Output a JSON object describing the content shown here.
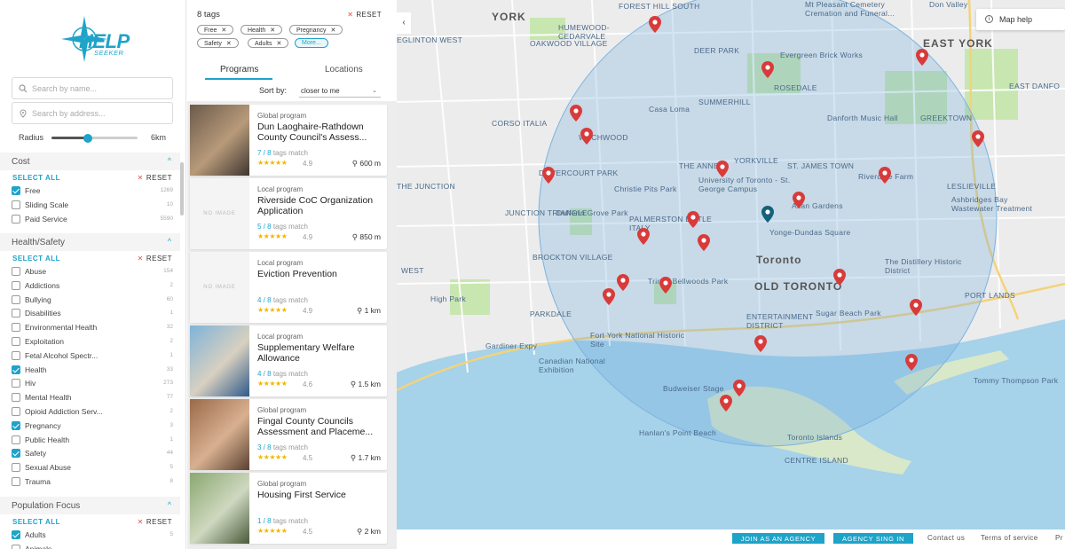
{
  "brand": {
    "name": "HELP",
    "sub": "SEEKER"
  },
  "search": {
    "name_placeholder": "Search by name...",
    "address_placeholder": "Search by address..."
  },
  "radius": {
    "label": "Radius",
    "value": "6km",
    "fraction": 0.42
  },
  "filters": {
    "select_all": "SELECT ALL",
    "reset": "RESET",
    "cost": {
      "title": "Cost",
      "items": [
        {
          "label": "Free",
          "count": "1269",
          "checked": true
        },
        {
          "label": "Sliding Scale",
          "count": "10",
          "checked": false
        },
        {
          "label": "Paid Service",
          "count": "5590",
          "checked": false
        }
      ]
    },
    "health": {
      "title": "Health/Safety",
      "items": [
        {
          "label": "Abuse",
          "count": "154",
          "checked": false
        },
        {
          "label": "Addictions",
          "count": "2",
          "checked": false
        },
        {
          "label": "Bullying",
          "count": "60",
          "checked": false
        },
        {
          "label": "Disabilities",
          "count": "1",
          "checked": false
        },
        {
          "label": "Environmental Health",
          "count": "32",
          "checked": false
        },
        {
          "label": "Exploitation",
          "count": "2",
          "checked": false
        },
        {
          "label": "Fetal Alcohol Spectr...",
          "count": "1",
          "checked": false
        },
        {
          "label": "Health",
          "count": "33",
          "checked": true
        },
        {
          "label": "Hiv",
          "count": "273",
          "checked": false
        },
        {
          "label": "Mental Health",
          "count": "77",
          "checked": false
        },
        {
          "label": "Opioid Addiction Serv...",
          "count": "2",
          "checked": false
        },
        {
          "label": "Pregnancy",
          "count": "3",
          "checked": true
        },
        {
          "label": "Public Health",
          "count": "1",
          "checked": false
        },
        {
          "label": "Safety",
          "count": "44",
          "checked": true
        },
        {
          "label": "Sexual Abuse",
          "count": "5",
          "checked": false
        },
        {
          "label": "Trauma",
          "count": "8",
          "checked": false
        }
      ]
    },
    "population": {
      "title": "Population Focus",
      "items": [
        {
          "label": "Adults",
          "count": "5",
          "checked": true
        },
        {
          "label": "Animals",
          "count": "",
          "checked": false
        }
      ]
    }
  },
  "tags": {
    "count_label": "8 tags",
    "reset": "RESET",
    "items": [
      "Free",
      "Health",
      "Pregnancy",
      "Safety",
      "Adults"
    ],
    "more": "More..."
  },
  "tabs": {
    "programs": "Programs",
    "locations": "Locations"
  },
  "sort": {
    "label": "Sort by:",
    "value": "closer to me"
  },
  "results": [
    {
      "kind": "Global program",
      "title": "Dun Laoghaire-Rathdown County Council's Assess...",
      "match": "7 / 8",
      "match_suffix": "tags match",
      "stars": "★★★★★",
      "rating": "4.9",
      "distance": "600 m",
      "image": "photo",
      "no_image": ""
    },
    {
      "kind": "Local program",
      "title": "Riverside CoC Organization Application",
      "match": "5 / 8",
      "match_suffix": "tags match",
      "stars": "★★★★★",
      "rating": "4.9",
      "distance": "850 m",
      "image": "none",
      "no_image": "NO IMAGE"
    },
    {
      "kind": "Local program",
      "title": "Eviction Prevention",
      "match": "4 / 8",
      "match_suffix": "tags match",
      "stars": "★★★★★",
      "rating": "4.9",
      "distance": "1 km",
      "image": "none",
      "no_image": "NO IMAGE"
    },
    {
      "kind": "Local program",
      "title": "Supplementary Welfare Allowance",
      "match": "4 / 8",
      "match_suffix": "tags match",
      "stars": "★★★★★",
      "rating": "4.6",
      "distance": "1.5 km",
      "image": "photo",
      "no_image": ""
    },
    {
      "kind": "Global program",
      "title": "Fingal County Councils Assessment and Placeme...",
      "match": "3 / 8",
      "match_suffix": "tags match",
      "stars": "★★★★★",
      "rating": "4.5",
      "distance": "1.7 km",
      "image": "photo",
      "no_image": ""
    },
    {
      "kind": "Global program",
      "title": "Housing First Service",
      "match": "1 / 8",
      "match_suffix": "tags match",
      "stars": "★★★★★",
      "rating": "4.5",
      "distance": "2 km",
      "image": "photo",
      "no_image": ""
    }
  ],
  "map": {
    "help": "Map help",
    "labels": [
      {
        "t": "YORK",
        "big": true
      },
      {
        "t": "FOREST HILL SOUTH",
        "big": false
      },
      {
        "t": "HUMEWOOD-CEDARVALE",
        "big": false
      },
      {
        "t": "EGLINTON WEST",
        "big": false
      },
      {
        "t": "OAKWOOD VILLAGE",
        "big": false
      },
      {
        "t": "DEER PARK",
        "big": false
      },
      {
        "t": "Evergreen Brick Works",
        "big": false
      },
      {
        "t": "EAST YORK",
        "big": true
      },
      {
        "t": "ROSEDALE",
        "big": false
      },
      {
        "t": "SUMMERHILL",
        "big": false
      },
      {
        "t": "Casa Loma",
        "big": false
      },
      {
        "t": "CORSO ITALIA",
        "big": false
      },
      {
        "t": "WYCHWOOD",
        "big": false
      },
      {
        "t": "Danforth Music Hall",
        "big": false
      },
      {
        "t": "GREEKTOWN",
        "big": false
      },
      {
        "t": "THE ANNEX",
        "big": false
      },
      {
        "t": "YORKVILLE",
        "big": false
      },
      {
        "t": "ST. JAMES TOWN",
        "big": false
      },
      {
        "t": "THE JUNCTION",
        "big": false
      },
      {
        "t": "DOVERCOURT PARK",
        "big": false
      },
      {
        "t": "Christie Pits Park",
        "big": false
      },
      {
        "t": "University of Toronto - St. George Campus",
        "big": false
      },
      {
        "t": "Allan Gardens",
        "big": false
      },
      {
        "t": "Riverdale Farm",
        "big": false
      },
      {
        "t": "LESLIEVILLE",
        "big": false
      },
      {
        "t": "JUNCTION TRIANGLE",
        "big": false
      },
      {
        "t": "Dufferin Grove Park",
        "big": false
      },
      {
        "t": "PALMERSTON LITTLE ITALY",
        "big": false
      },
      {
        "t": "Yonge-Dundas Square",
        "big": false
      },
      {
        "t": "Ashbridges Bay Wastewater Treatment",
        "big": false
      },
      {
        "t": "Toronto",
        "big": true
      },
      {
        "t": "BROCKTON VILLAGE",
        "big": false
      },
      {
        "t": "OLD TORONTO",
        "big": true
      },
      {
        "t": "The Distillery Historic District",
        "big": false
      },
      {
        "t": "Trinity Bellwoods Park",
        "big": false
      },
      {
        "t": "WEST",
        "big": false
      },
      {
        "t": "High Park",
        "big": false
      },
      {
        "t": "PORT LANDS",
        "big": false
      },
      {
        "t": "PARKDALE",
        "big": false
      },
      {
        "t": "ENTERTAINMENT DISTRICT",
        "big": false
      },
      {
        "t": "Sugar Beach Park",
        "big": false
      },
      {
        "t": "Fort York National Historic Site",
        "big": false
      },
      {
        "t": "Canadian National Exhibition",
        "big": false
      },
      {
        "t": "Budweiser Stage",
        "big": false
      },
      {
        "t": "Tommy Thompson Park",
        "big": false
      },
      {
        "t": "Hanlan's Point Beach",
        "big": false
      },
      {
        "t": "Toronto Islands",
        "big": false
      },
      {
        "t": "CENTRE ISLAND",
        "big": false
      },
      {
        "t": "Gardiner Expy",
        "big": false
      },
      {
        "t": "Don Valley",
        "big": false
      },
      {
        "t": "Mt Pleasant Cemetery Cremation and Funeral...",
        "big": false
      },
      {
        "t": "EAST DANFO",
        "big": false
      }
    ]
  },
  "footer": {
    "join": "JOIN AS AN AGENCY",
    "signin": "AGENCY SING IN",
    "contact": "Contact us",
    "terms": "Terms of service",
    "privacy": "Pr"
  },
  "colors": {
    "accent": "#1ea3c9",
    "pin": "#d93a3a",
    "pin_selected": "#15607a",
    "water": "#a6d2ea",
    "park": "#c8e6b0"
  }
}
